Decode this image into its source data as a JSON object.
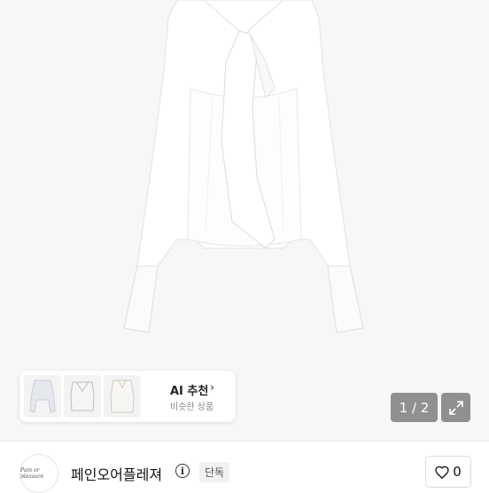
{
  "ai_card": {
    "title": "AI 추천",
    "subtitle": "비슷한 상품",
    "chevron": "chevron-right-icon"
  },
  "pager": {
    "text": "1 / 2"
  },
  "expand": {
    "icon": "expand-icon"
  },
  "shop": {
    "name": "페인오어플레져",
    "avatar_text": "Pain or pleasure",
    "badge": "단독"
  },
  "like": {
    "icon": "heart-icon",
    "count": "0"
  }
}
